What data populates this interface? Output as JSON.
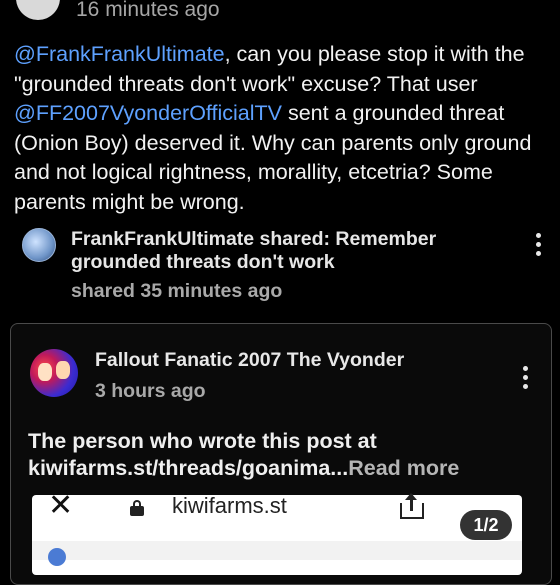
{
  "top": {
    "time": "16 minutes ago"
  },
  "comment": {
    "mention1": "@FrankFrankUltimate",
    "text1": ", can you please stop it with the \"grounded threats don't work\" excuse? That user ",
    "mention2": "@FF2007VyonderOfficialTV",
    "text2": " sent a grounded threat (Onion Boy) deserved it. Why can parents only ground and not logical rightness, morallity, etcetria? Some parents might be wrong."
  },
  "shared": {
    "title": "FrankFrankUltimate shared: Remember grounded threats don't work",
    "time": "shared 35 minutes ago"
  },
  "card": {
    "author": "Fallout Fanatic 2007 The Vyonder",
    "time": "3 hours ago",
    "text": "The person who wrote this post at kiwifarms.st/threads/goanima...",
    "read_more": "Read more"
  },
  "preview": {
    "close": "✕",
    "domain": "kiwifarms.st",
    "page_indicator": "1/2"
  },
  "colors": {
    "mention": "#5ea1ff",
    "background": "#000000"
  }
}
